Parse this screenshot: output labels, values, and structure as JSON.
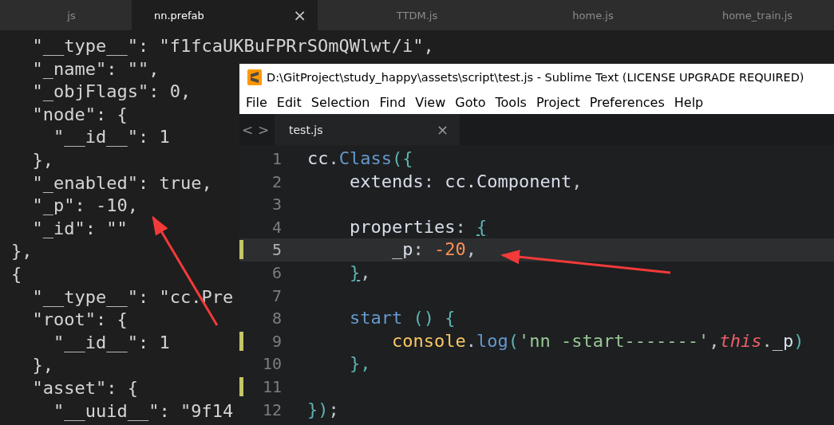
{
  "back_editor": {
    "tabs": [
      {
        "label": "js",
        "selected": false,
        "closable": false
      },
      {
        "label": "nn.prefab",
        "selected": true,
        "closable": true
      },
      {
        "label": "TTDM.js",
        "selected": false,
        "closable": false
      },
      {
        "label": "home.js",
        "selected": false,
        "closable": false
      },
      {
        "label": "home_train.js",
        "selected": false,
        "closable": false
      }
    ],
    "close_glyph": "×",
    "lines": [
      "  \"__type__\": \"f1fcaUKBuFPRrSOmQWlwt/i\",",
      "  \"_name\": \"\",",
      "  \"_objFlags\": 0,",
      "  \"node\": {",
      "    \"__id__\": 1",
      "  },",
      "  \"_enabled\": true,",
      "  \"_p\": -10,",
      "  \"_id\": \"\"",
      "},",
      "{",
      "  \"__type__\": \"cc.Pre",
      "  \"root\": {",
      "    \"__id__\": 1",
      "  },",
      "  \"asset\": {",
      "    \"__uuid__\": \"9f14"
    ]
  },
  "sublime_window": {
    "title": "D:\\GitProject\\study_happy\\assets\\script\\test.js - Sublime Text (LICENSE UPGRADE REQUIRED)",
    "menu": [
      "File",
      "Edit",
      "Selection",
      "Find",
      "View",
      "Goto",
      "Tools",
      "Project",
      "Preferences",
      "Help"
    ],
    "nav": [
      "<",
      ">"
    ],
    "tab": {
      "label": "test.js",
      "close": "×",
      "selected": true
    },
    "lines": [
      {
        "number": "1",
        "current": false,
        "modified": false,
        "tokens": [
          {
            "t": "cc",
            "kind": "plain"
          },
          {
            "t": ".",
            "kind": "punct"
          },
          {
            "t": "Class",
            "kind": "func"
          },
          {
            "t": "({",
            "kind": "brace"
          }
        ]
      },
      {
        "number": "2",
        "current": false,
        "modified": false,
        "tokens": [
          {
            "t": "    extends",
            "kind": "plain"
          },
          {
            "t": ":",
            "kind": "punct"
          },
          {
            "t": " cc.Component",
            "kind": "plain"
          },
          {
            "t": ",",
            "kind": "punct"
          }
        ]
      },
      {
        "number": "3",
        "current": false,
        "modified": false
      },
      {
        "number": "4",
        "current": false,
        "modified": false,
        "tokens": [
          {
            "t": "    properties",
            "kind": "plain"
          },
          {
            "t": ":",
            "kind": "punct"
          },
          {
            "t": " {",
            "kind": "brace",
            "matched": true
          }
        ]
      },
      {
        "number": "5",
        "current": true,
        "modified": true,
        "tokens": [
          {
            "t": "        _p",
            "kind": "plain"
          },
          {
            "t": ":",
            "kind": "punct"
          },
          {
            "t": " -20",
            "kind": "number"
          },
          {
            "t": ",",
            "kind": "punct"
          }
        ]
      },
      {
        "number": "6",
        "current": false,
        "modified": false,
        "tokens": [
          {
            "t": "    }",
            "kind": "brace",
            "matched": true
          },
          {
            "t": ",",
            "kind": "punct"
          }
        ]
      },
      {
        "number": "7",
        "current": false,
        "modified": false
      },
      {
        "number": "8",
        "current": false,
        "modified": false,
        "tokens": [
          {
            "t": "    start",
            "kind": "func"
          },
          {
            "t": " ()",
            "kind": "brace"
          },
          {
            "t": " {",
            "kind": "brace"
          }
        ]
      },
      {
        "number": "9",
        "current": false,
        "modified": true,
        "tokens": [
          {
            "t": "        console",
            "kind": "builtin"
          },
          {
            "t": ".",
            "kind": "punct"
          },
          {
            "t": "log",
            "kind": "func"
          },
          {
            "t": "(",
            "kind": "brace"
          },
          {
            "t": "'nn -start-------'",
            "kind": "string"
          },
          {
            "t": ",",
            "kind": "punct"
          },
          {
            "t": "this",
            "kind": "keyword"
          },
          {
            "t": ".",
            "kind": "punct"
          },
          {
            "t": "_p",
            "kind": "plain"
          },
          {
            "t": ")",
            "kind": "brace"
          }
        ]
      },
      {
        "number": "10",
        "current": false,
        "modified": false,
        "tokens": [
          {
            "t": "    },",
            "kind": "brace"
          }
        ]
      },
      {
        "number": "11",
        "current": false,
        "modified": true
      },
      {
        "number": "12",
        "current": false,
        "modified": false,
        "tokens": [
          {
            "t": "})",
            "kind": "brace"
          },
          {
            "t": ";",
            "kind": "punct"
          }
        ]
      }
    ]
  }
}
